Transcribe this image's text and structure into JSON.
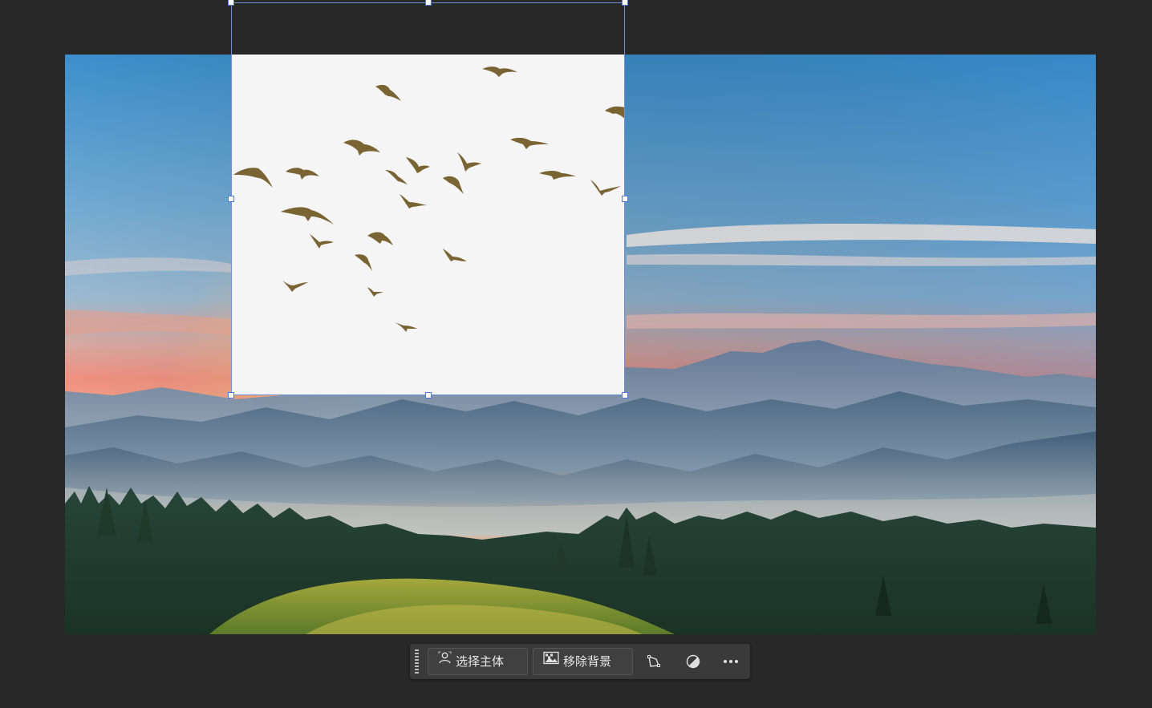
{
  "canvas": {
    "background_color": "#282828",
    "photo_subject": "mountain-sunrise-landscape",
    "layer_subject": "flock-of-birds"
  },
  "contextual_task_bar": {
    "select_subject_label": "选择主体",
    "select_subject_icon": "select-subject-icon",
    "remove_background_label": "移除背景",
    "remove_background_icon": "remove-background-icon",
    "transform_icon": "transform-icon",
    "adjustment_icon": "adjustment-icon",
    "more_icon": "more-options-icon"
  },
  "selection": {
    "frame_color": "#6f8fd6",
    "handle_color": "#ffffff"
  }
}
